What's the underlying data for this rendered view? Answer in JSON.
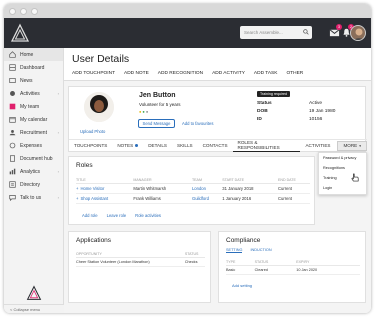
{
  "topbar": {
    "search_placeholder": "Search Assemble...",
    "messages_badge": "3",
    "notifications_badge": "2"
  },
  "sidebar": {
    "items": [
      {
        "label": "Home",
        "icon": "home-icon",
        "chevron": false
      },
      {
        "label": "Dashboard",
        "icon": "dashboard-icon",
        "chevron": false
      },
      {
        "label": "News",
        "icon": "news-icon",
        "chevron": false
      },
      {
        "label": "Activities",
        "icon": "activities-icon",
        "chevron": true
      },
      {
        "label": "My team",
        "icon": "team-icon",
        "chevron": false
      },
      {
        "label": "My calendar",
        "icon": "calendar-icon",
        "chevron": false
      },
      {
        "label": "Recruitment",
        "icon": "recruitment-icon",
        "chevron": true
      },
      {
        "label": "Expenses",
        "icon": "expenses-icon",
        "chevron": false
      },
      {
        "label": "Document hub",
        "icon": "document-icon",
        "chevron": false
      },
      {
        "label": "Analytics",
        "icon": "analytics-icon",
        "chevron": true
      },
      {
        "label": "Directory",
        "icon": "directory-icon",
        "chevron": false
      },
      {
        "label": "Talk to us",
        "icon": "talk-icon",
        "chevron": true
      }
    ],
    "collapse_label": "< Collapse menu"
  },
  "page": {
    "title": "User Details",
    "actions": [
      "ADD TOUCHPOINT",
      "ADD NOTE",
      "ADD RECOGNITION",
      "ADD ACTIVITY",
      "ADD TASK",
      "OTHER"
    ]
  },
  "profile": {
    "name": "Jen Button",
    "role": "Volunteer for 5 years",
    "upload_label": "Upload Photo",
    "send_message_label": "Send Message",
    "favourites_label": "Add to favourites",
    "tag": "Training required",
    "fields": [
      {
        "key": "Status",
        "value": "Active"
      },
      {
        "key": "DOB",
        "value": "19 Jan 1980"
      },
      {
        "key": "ID",
        "value": "10156"
      }
    ]
  },
  "tabs": [
    {
      "label": "TOUCHPOINTS",
      "dot": false
    },
    {
      "label": "NOTES",
      "dot": true
    },
    {
      "label": "DETAILS",
      "dot": false
    },
    {
      "label": "SKILLS",
      "dot": false
    },
    {
      "label": "CONTACTS",
      "dot": false
    },
    {
      "label": "ROLES & RESPONSIBILITIES",
      "dot": false,
      "selected": true
    },
    {
      "label": "ACTIVITIES",
      "dot": false
    },
    {
      "label": "MORE",
      "dot": false,
      "more": true
    }
  ],
  "more_menu": [
    "Password & privacy",
    "Recognitions",
    "Training",
    "Login"
  ],
  "roles": {
    "title": "Roles",
    "columns": [
      "TITLE",
      "MANAGER",
      "TEAM",
      "START DATE",
      "END DATE"
    ],
    "rows": [
      [
        "Home Visitor",
        "Martin Whitmarsh",
        "London",
        "31 January 2018",
        "Current"
      ],
      [
        "Shop Assistant",
        "Frank Williams",
        "Guildford",
        "1 January 2016",
        "Current"
      ]
    ],
    "actions": [
      "Add role",
      "Leave role",
      "Role activities"
    ]
  },
  "applications": {
    "title": "Applications",
    "columns": [
      "OPPORTUNITY",
      "STATUS"
    ],
    "rows": [
      [
        "Cheer Station Volunteer (London Marathon)",
        "Checks"
      ]
    ]
  },
  "compliance": {
    "title": "Compliance",
    "subtabs": [
      "SETTING",
      "INDUCTION"
    ],
    "columns": [
      "TYPE",
      "STATUS",
      "EXPIRY"
    ],
    "rows": [
      [
        "Basic",
        "Cleared",
        "10 Jan 2020"
      ]
    ],
    "add_label": "Add setting"
  },
  "colors": {
    "topbar": "#2b2d33",
    "link": "#2a6ebb",
    "badge": "#e0206c"
  }
}
